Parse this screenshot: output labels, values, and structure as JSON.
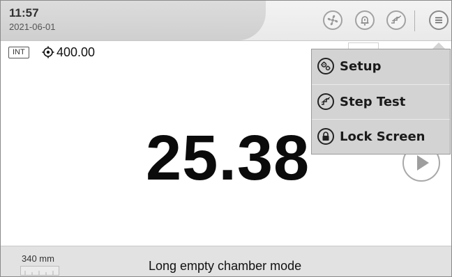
{
  "status": {
    "time": "11:57",
    "date": "2021-06-01"
  },
  "header_icons": [
    "fan-icon",
    "alarm-bell-icon",
    "step-test-icon",
    "menu-icon"
  ],
  "indicator": {
    "int_badge": "INT",
    "setpoint": "400.00"
  },
  "reading": {
    "value": "25.38"
  },
  "menu": {
    "items": [
      {
        "label": "Setup",
        "icon": "setup-gears-icon"
      },
      {
        "label": "Step Test",
        "icon": "step-test-icon"
      },
      {
        "label": "Lock Screen",
        "icon": "lock-icon"
      }
    ]
  },
  "footer": {
    "distance": "340 mm",
    "mode_text": "Long empty chamber mode"
  }
}
